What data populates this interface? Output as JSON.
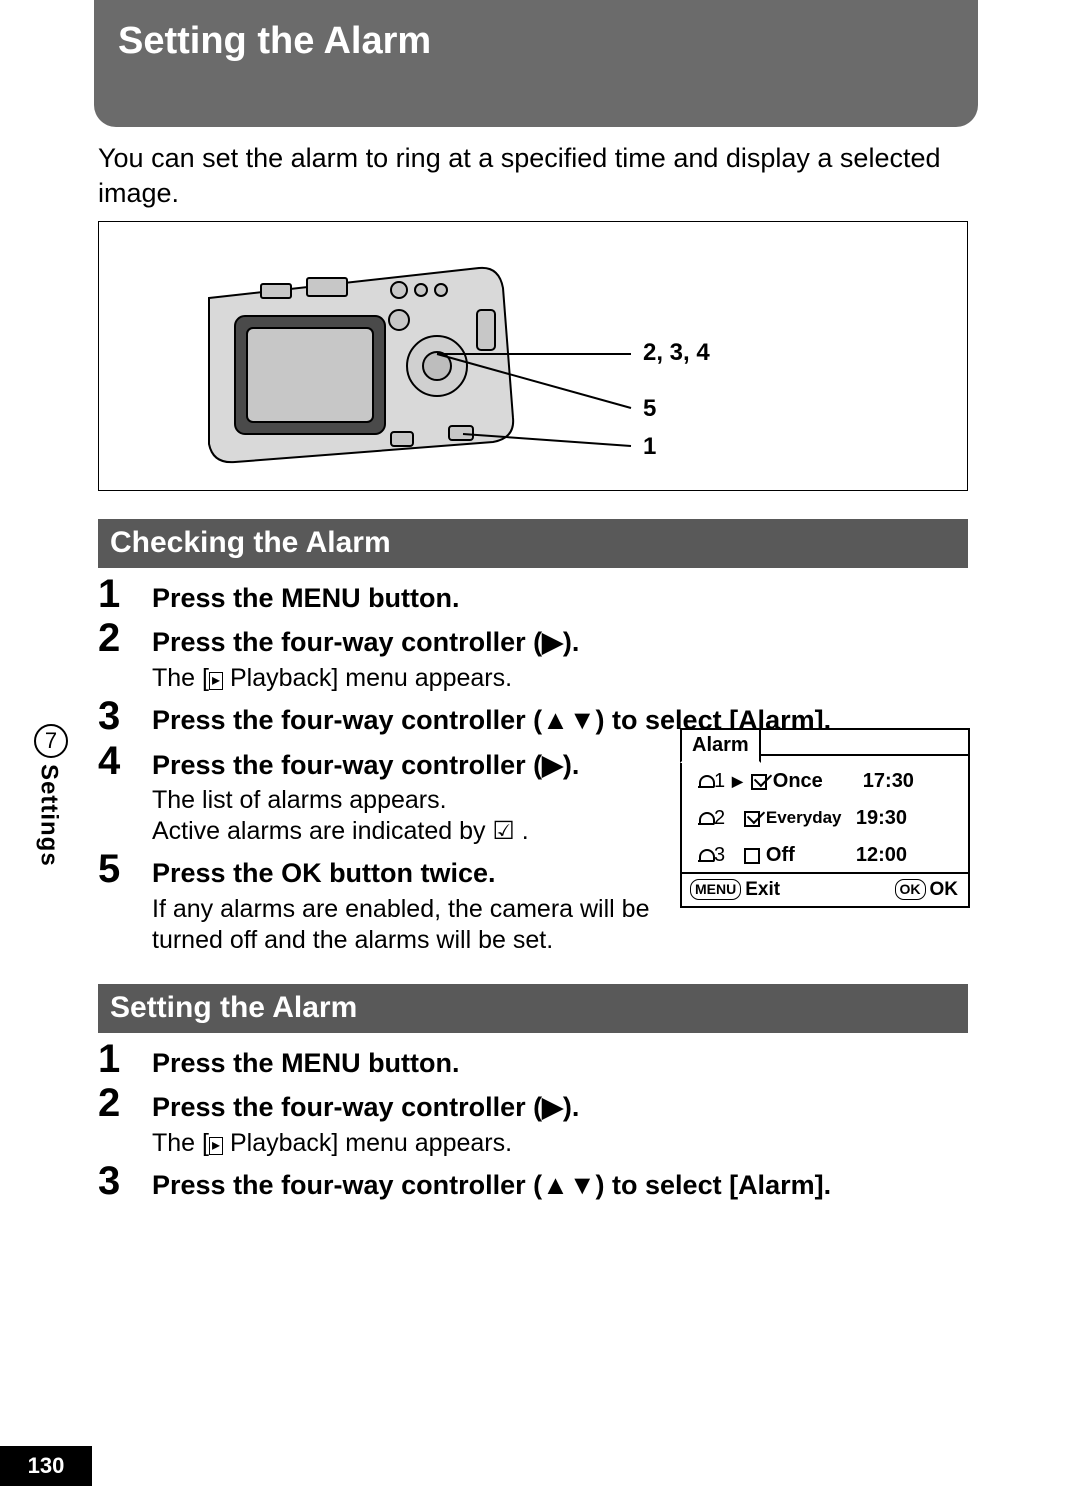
{
  "page_number": "130",
  "section_tab": {
    "number": "7",
    "label": "Settings"
  },
  "title": "Setting the Alarm",
  "intro": "You can set the alarm to ring at a specified time and display a selected image.",
  "illustration": {
    "callouts": [
      {
        "label": "2, 3, 4"
      },
      {
        "label": "5"
      },
      {
        "label": "1"
      }
    ]
  },
  "sections": [
    {
      "header": "Checking the Alarm",
      "steps": [
        {
          "num": "1",
          "title": "Press the MENU button."
        },
        {
          "num": "2",
          "title": "Press the four-way controller (▶).",
          "note_parts": [
            "The [",
            " Playback] menu appears."
          ]
        },
        {
          "num": "3",
          "title": "Press the four-way controller (▲▼) to select [Alarm]."
        },
        {
          "num": "4",
          "title": "Press the four-way controller (▶).",
          "note": "The list of alarms appears.\nActive alarms are indicated by ☑ ."
        },
        {
          "num": "5",
          "title": "Press the OK button twice.",
          "note": "If any alarms are enabled, the camera will be turned off and the alarms will be set."
        }
      ]
    },
    {
      "header": "Setting the Alarm",
      "steps": [
        {
          "num": "1",
          "title": "Press the MENU button."
        },
        {
          "num": "2",
          "title": "Press the four-way controller (▶).",
          "note_parts": [
            "The [",
            " Playback] menu appears."
          ]
        },
        {
          "num": "3",
          "title": "Press the four-way controller (▲▼) to select [Alarm]."
        }
      ]
    }
  ],
  "alarm_screen": {
    "tab": "Alarm",
    "rows": [
      {
        "id": "1",
        "selected": true,
        "checked": true,
        "mode": "Once",
        "time": "17:30"
      },
      {
        "id": "2",
        "selected": false,
        "checked": true,
        "mode": "Everyday",
        "time": "19:30"
      },
      {
        "id": "3",
        "selected": false,
        "checked": false,
        "mode": "Off",
        "time": "12:00"
      }
    ],
    "footer": {
      "left_btn": "MENU",
      "left_label": "Exit",
      "right_btn": "OK",
      "right_label": "OK"
    }
  }
}
